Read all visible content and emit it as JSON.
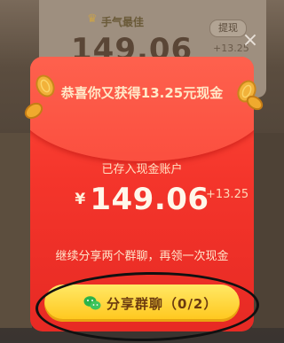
{
  "background": {
    "tag": "手气最佳",
    "withdraw_label": "提现",
    "amount": "149.06",
    "plus": "+13.25"
  },
  "modal": {
    "title": "恭喜你又获得13.25元现金",
    "subtitle": "已存入现金账户",
    "currency": "¥",
    "amount": "149.06",
    "added": "+13.25",
    "hint": "继续分享两个群聊，再领一次现金",
    "share_button_label": "分享群聊（0/2）",
    "close_glyph": "×"
  },
  "icons": {
    "close": "close-icon",
    "wechat": "wechat-icon",
    "coins": "coin-icon"
  },
  "colors": {
    "envelope": "#f4352b",
    "button": "#ffc61a",
    "title_text": "#ffe9c8"
  }
}
